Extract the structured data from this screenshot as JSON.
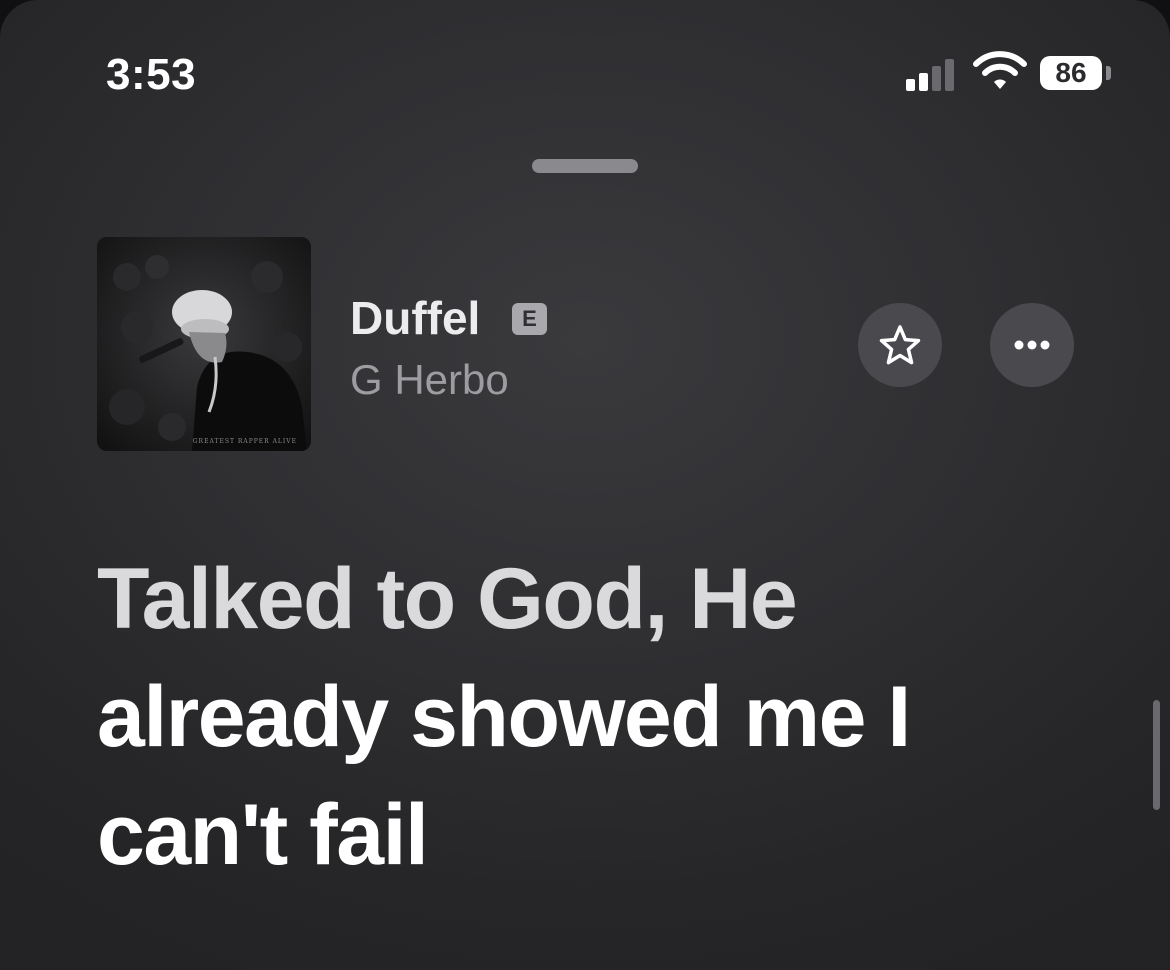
{
  "status_bar": {
    "time": "3:53",
    "battery": "86",
    "signal_icon": "cellular-signal-icon",
    "wifi_icon": "wifi-icon",
    "battery_icon": "battery-icon"
  },
  "sheet": {
    "grabber": "sheet-grabber"
  },
  "track": {
    "title": "Duffel",
    "explicit_badge": "E",
    "artist": "G Herbo",
    "artwork_caption": "GREATEST RAPPER ALIVE",
    "favorite_icon": "star-icon",
    "more_icon": "ellipsis-icon"
  },
  "lyrics": {
    "lines": [
      "Talked to God, He",
      "already showed me I",
      "can't fail"
    ]
  },
  "colors": {
    "background": "#2f2f32",
    "button_fill": "#4a4a4e",
    "secondary_text": "#9c9ca1",
    "explicit_badge": "#a8a8ad"
  }
}
